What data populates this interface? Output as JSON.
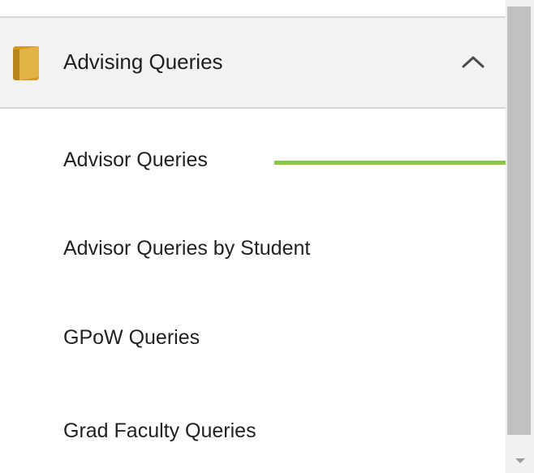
{
  "section": {
    "title": "Advising Queries",
    "icon": "folder-icon",
    "expanded": true,
    "collapse_icon": "chevron-up-icon"
  },
  "menu": {
    "items": [
      {
        "label": "Advisor Queries"
      },
      {
        "label": "Advisor Queries by Student"
      },
      {
        "label": "GPoW Queries"
      },
      {
        "label": "Grad Faculty Queries"
      }
    ]
  },
  "colors": {
    "accent": "#8bc63f",
    "folder": "#d7a32f",
    "header_bg": "#f2f2f2",
    "scroll_thumb": "#c1c1c1"
  }
}
